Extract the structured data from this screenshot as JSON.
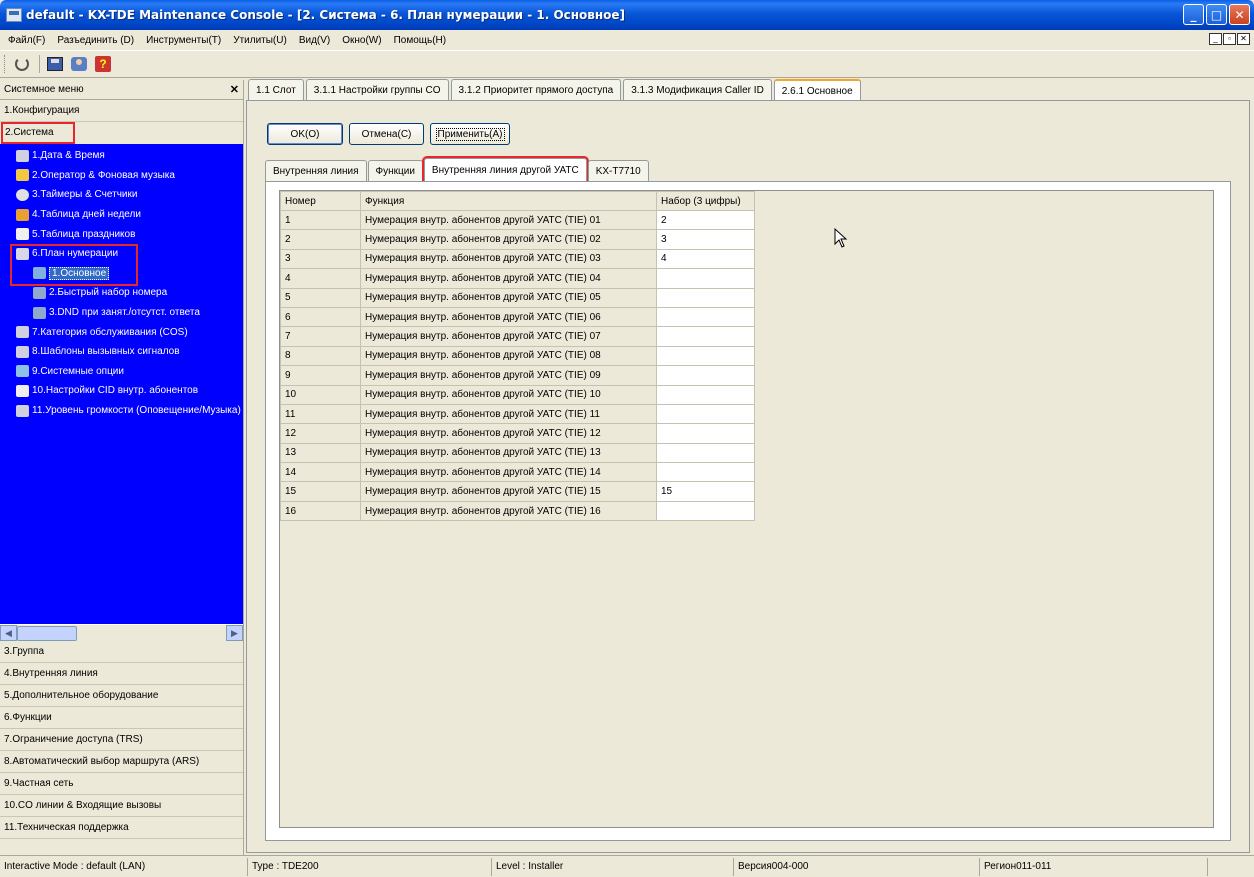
{
  "window": {
    "title": "default - KX-TDE Maintenance Console - [2. Система - 6. План нумерации - 1. Основное]"
  },
  "menu": [
    "Файл(F)",
    "Разъединить (D)",
    "Инструменты(T)",
    "Утилиты(U)",
    "Вид(V)",
    "Окно(W)",
    "Помощь(H)"
  ],
  "left_panel": {
    "header": "Системное меню",
    "sections_top": [
      "1.Конфигурация",
      "2.Система"
    ],
    "tree": [
      {
        "label": "1.Дата & Время",
        "level": 1
      },
      {
        "label": "2.Оператор & Фоновая музыка",
        "level": 1
      },
      {
        "label": "3.Таймеры & Счетчики",
        "level": 1
      },
      {
        "label": "4.Таблица дней недели",
        "level": 1
      },
      {
        "label": "5.Таблица праздников",
        "level": 1
      },
      {
        "label": "6.План нумерации",
        "level": 1
      },
      {
        "label": "1.Основное",
        "level": 2,
        "selected": true
      },
      {
        "label": "2.Быстрый набор номера",
        "level": 2
      },
      {
        "label": "3.DND при занят./отсутст. ответа",
        "level": 2
      },
      {
        "label": "7.Категория обслуживания (COS)",
        "level": 1
      },
      {
        "label": "8.Шаблоны вызывных сигналов",
        "level": 1
      },
      {
        "label": "9.Системные опции",
        "level": 1
      },
      {
        "label": "10.Настройки CID внутр. абонентов",
        "level": 1
      },
      {
        "label": "11.Уровень громкости (Оповещение/Музыка)",
        "level": 1
      }
    ],
    "sections_bottom": [
      "3.Группа",
      "4.Внутренняя линия",
      "5.Дополнительное оборудование",
      "6.Функции",
      "7.Ограничение доступа (TRS)",
      "8.Автоматический выбор маршрута (ARS)",
      "9.Частная сеть",
      "10.CO линии & Входящие вызовы",
      "11.Техническая поддержка"
    ]
  },
  "tabs": [
    "1.1 Слот",
    "3.1.1 Настройки группы CO",
    "3.1.2 Приоритет прямого доступа",
    "3.1.3 Модификация Caller ID",
    "2.6.1 Основное"
  ],
  "buttons": {
    "ok": "OK(O)",
    "cancel": "Отмена(C)",
    "apply": "Применить(A)"
  },
  "subtabs": [
    "Внутренняя линия",
    "Функции",
    "Внутренняя линия другой УАТС",
    "KX-T7710"
  ],
  "table": {
    "headers": [
      "Номер",
      "Функция",
      "Набор (3 цифры)"
    ],
    "rows": [
      [
        "1",
        "Нумерация внутр. абонентов другой УАТС (TIE) 01",
        "2"
      ],
      [
        "2",
        "Нумерация внутр. абонентов другой УАТС (TIE) 02",
        "3"
      ],
      [
        "3",
        "Нумерация внутр. абонентов другой УАТС (TIE) 03",
        "4"
      ],
      [
        "4",
        "Нумерация внутр. абонентов другой УАТС (TIE) 04",
        ""
      ],
      [
        "5",
        "Нумерация внутр. абонентов другой УАТС (TIE) 05",
        ""
      ],
      [
        "6",
        "Нумерация внутр. абонентов другой УАТС (TIE) 06",
        ""
      ],
      [
        "7",
        "Нумерация внутр. абонентов другой УАТС (TIE) 07",
        ""
      ],
      [
        "8",
        "Нумерация внутр. абонентов другой УАТС (TIE) 08",
        ""
      ],
      [
        "9",
        "Нумерация внутр. абонентов другой УАТС (TIE) 09",
        ""
      ],
      [
        "10",
        "Нумерация внутр. абонентов другой УАТС (TIE) 10",
        ""
      ],
      [
        "11",
        "Нумерация внутр. абонентов другой УАТС (TIE) 11",
        ""
      ],
      [
        "12",
        "Нумерация внутр. абонентов другой УАТС (TIE) 12",
        ""
      ],
      [
        "13",
        "Нумерация внутр. абонентов другой УАТС (TIE) 13",
        ""
      ],
      [
        "14",
        "Нумерация внутр. абонентов другой УАТС (TIE) 14",
        ""
      ],
      [
        "15",
        "Нумерация внутр. абонентов другой УАТС (TIE) 15",
        "15"
      ],
      [
        "16",
        "Нумерация внутр. абонентов другой УАТС (TIE) 16",
        ""
      ]
    ]
  },
  "status_bar": [
    "Interactive Mode : default (LAN)",
    "Type : TDE200",
    "Level : Installer",
    "Версия004-000",
    "Регион011-011"
  ],
  "colors": {
    "tree_bg": "#0000ff",
    "highlight_box": "#e8262c",
    "title_bar": "#0054e3"
  }
}
